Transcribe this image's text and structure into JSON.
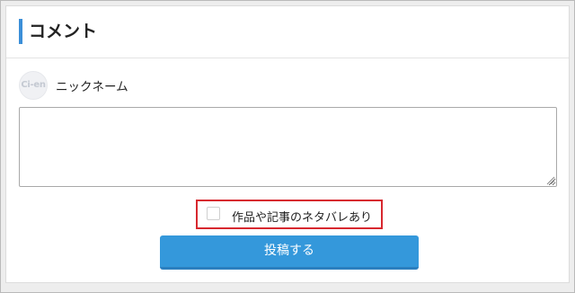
{
  "comments": {
    "heading": "コメント",
    "avatar_text": "Ci-en",
    "nickname": "ニックネーム",
    "comment_text": "",
    "spoiler_label": "作品や記事のネタバレあり",
    "spoiler_checked": false,
    "submit_label": "投稿する"
  },
  "colors": {
    "accent": "#3b8fd8",
    "button": "#3498db",
    "highlight_border": "#d7282f"
  }
}
